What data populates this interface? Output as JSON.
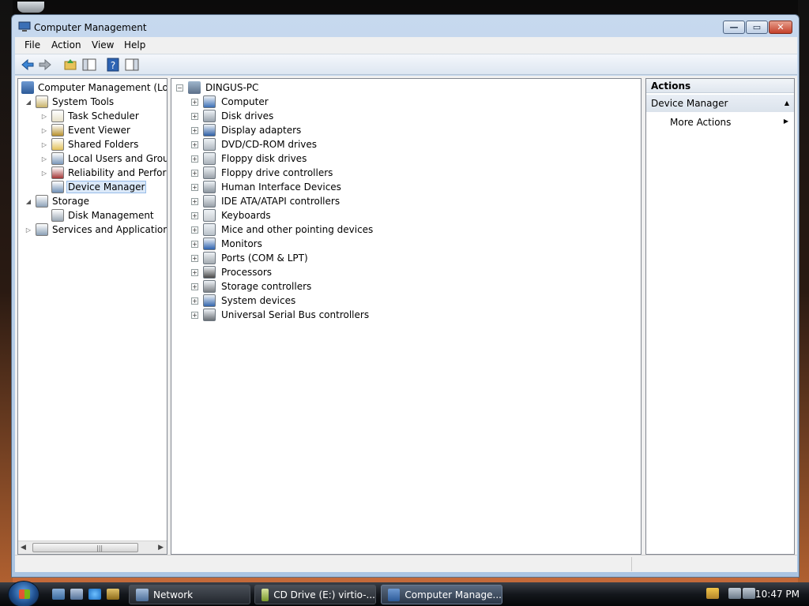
{
  "window": {
    "title": "Computer Management"
  },
  "menu": [
    "File",
    "Action",
    "View",
    "Help"
  ],
  "tree": {
    "root": "Computer Management (Local",
    "items": [
      {
        "label": "System Tools",
        "level": 1,
        "expanded": true
      },
      {
        "label": "Task Scheduler",
        "level": 2
      },
      {
        "label": "Event Viewer",
        "level": 2
      },
      {
        "label": "Shared Folders",
        "level": 2
      },
      {
        "label": "Local Users and Groups",
        "level": 2
      },
      {
        "label": "Reliability and Performa",
        "level": 2
      },
      {
        "label": "Device Manager",
        "level": 2,
        "selected": true
      },
      {
        "label": "Storage",
        "level": 1,
        "expanded": true
      },
      {
        "label": "Disk Management",
        "level": 2
      },
      {
        "label": "Services and Applications",
        "level": 1
      }
    ],
    "scroll_grip": "|||"
  },
  "devices": {
    "computer_name": "DINGUS-PC",
    "categories": [
      "Computer",
      "Disk drives",
      "Display adapters",
      "DVD/CD-ROM drives",
      "Floppy disk drives",
      "Floppy drive controllers",
      "Human Interface Devices",
      "IDE ATA/ATAPI controllers",
      "Keyboards",
      "Mice and other pointing devices",
      "Monitors",
      "Ports (COM & LPT)",
      "Processors",
      "Storage controllers",
      "System devices",
      "Universal Serial Bus controllers"
    ]
  },
  "actions": {
    "header": "Actions",
    "section": "Device Manager",
    "more": "More Actions"
  },
  "taskbar": {
    "tasks": [
      "Network",
      "CD Drive (E:) virtio-...",
      "Computer Manage..."
    ],
    "clock": "10:47 PM"
  }
}
